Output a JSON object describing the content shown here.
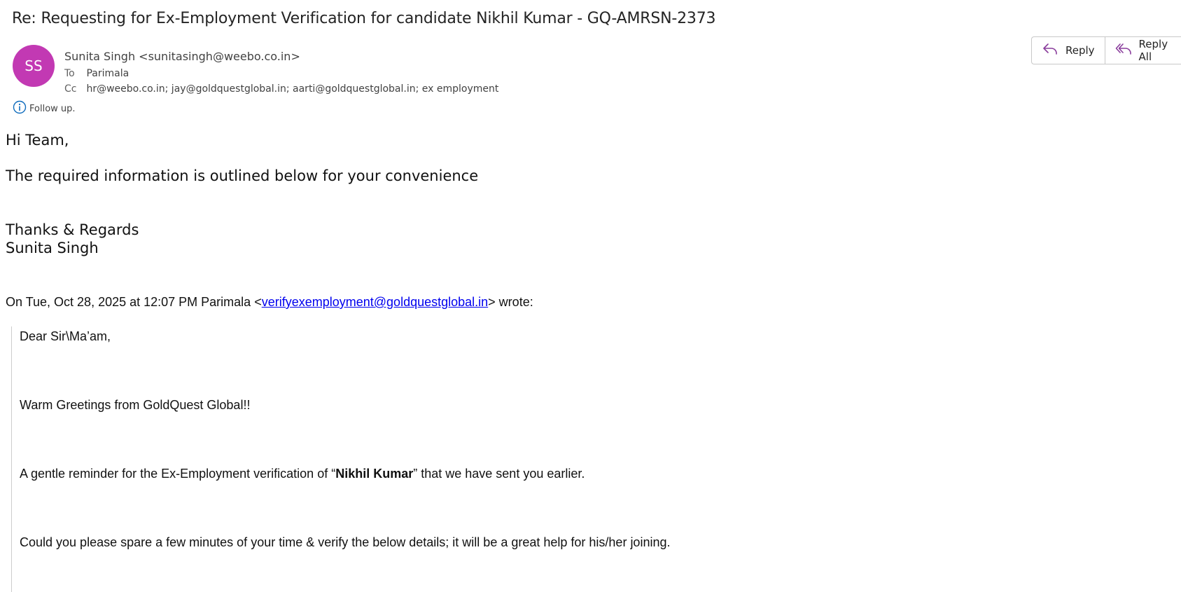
{
  "email": {
    "subject": "Re: Requesting for Ex-Employment Verification for candidate Nikhil Kumar - GQ-AMRSN-2373",
    "avatar_initials": "SS",
    "avatar_color": "#c239b3",
    "sender": "Sunita Singh <sunitasingh@weebo.co.in>",
    "to_label": "To",
    "to": "Parimala",
    "cc_label": "Cc",
    "cc": "hr@weebo.co.in; jay@goldquestglobal.in; aarti@goldquestglobal.in; ex employment",
    "follow_up": "Follow up."
  },
  "actions": {
    "reply": "Reply",
    "reply_all": "Reply All",
    "accent": "#8a3d9c"
  },
  "body": {
    "greeting": "Hi Team,",
    "line1": "The required information is outlined below for your convenience",
    "signoff1": "Thanks & Regards",
    "signoff2": "Sunita Singh"
  },
  "quoted": {
    "header_prefix": "On Tue, Oct 28, 2025 at 12:07 PM Parimala <",
    "header_link": "verifyexemployment@goldquestglobal.in",
    "header_suffix": "> wrote:",
    "salutation": "Dear Sir\\Ma’am,",
    "greetings": "Warm Greetings from GoldQuest Global!!",
    "reminder_before": "A gentle reminder for the Ex-Employment verification of “",
    "reminder_name": "Nikhil Kumar",
    "reminder_after": "” that we have sent you earlier.",
    "request": "Could you please spare a few minutes of your time & verify the below details; it will be a great help for his/her joining."
  }
}
